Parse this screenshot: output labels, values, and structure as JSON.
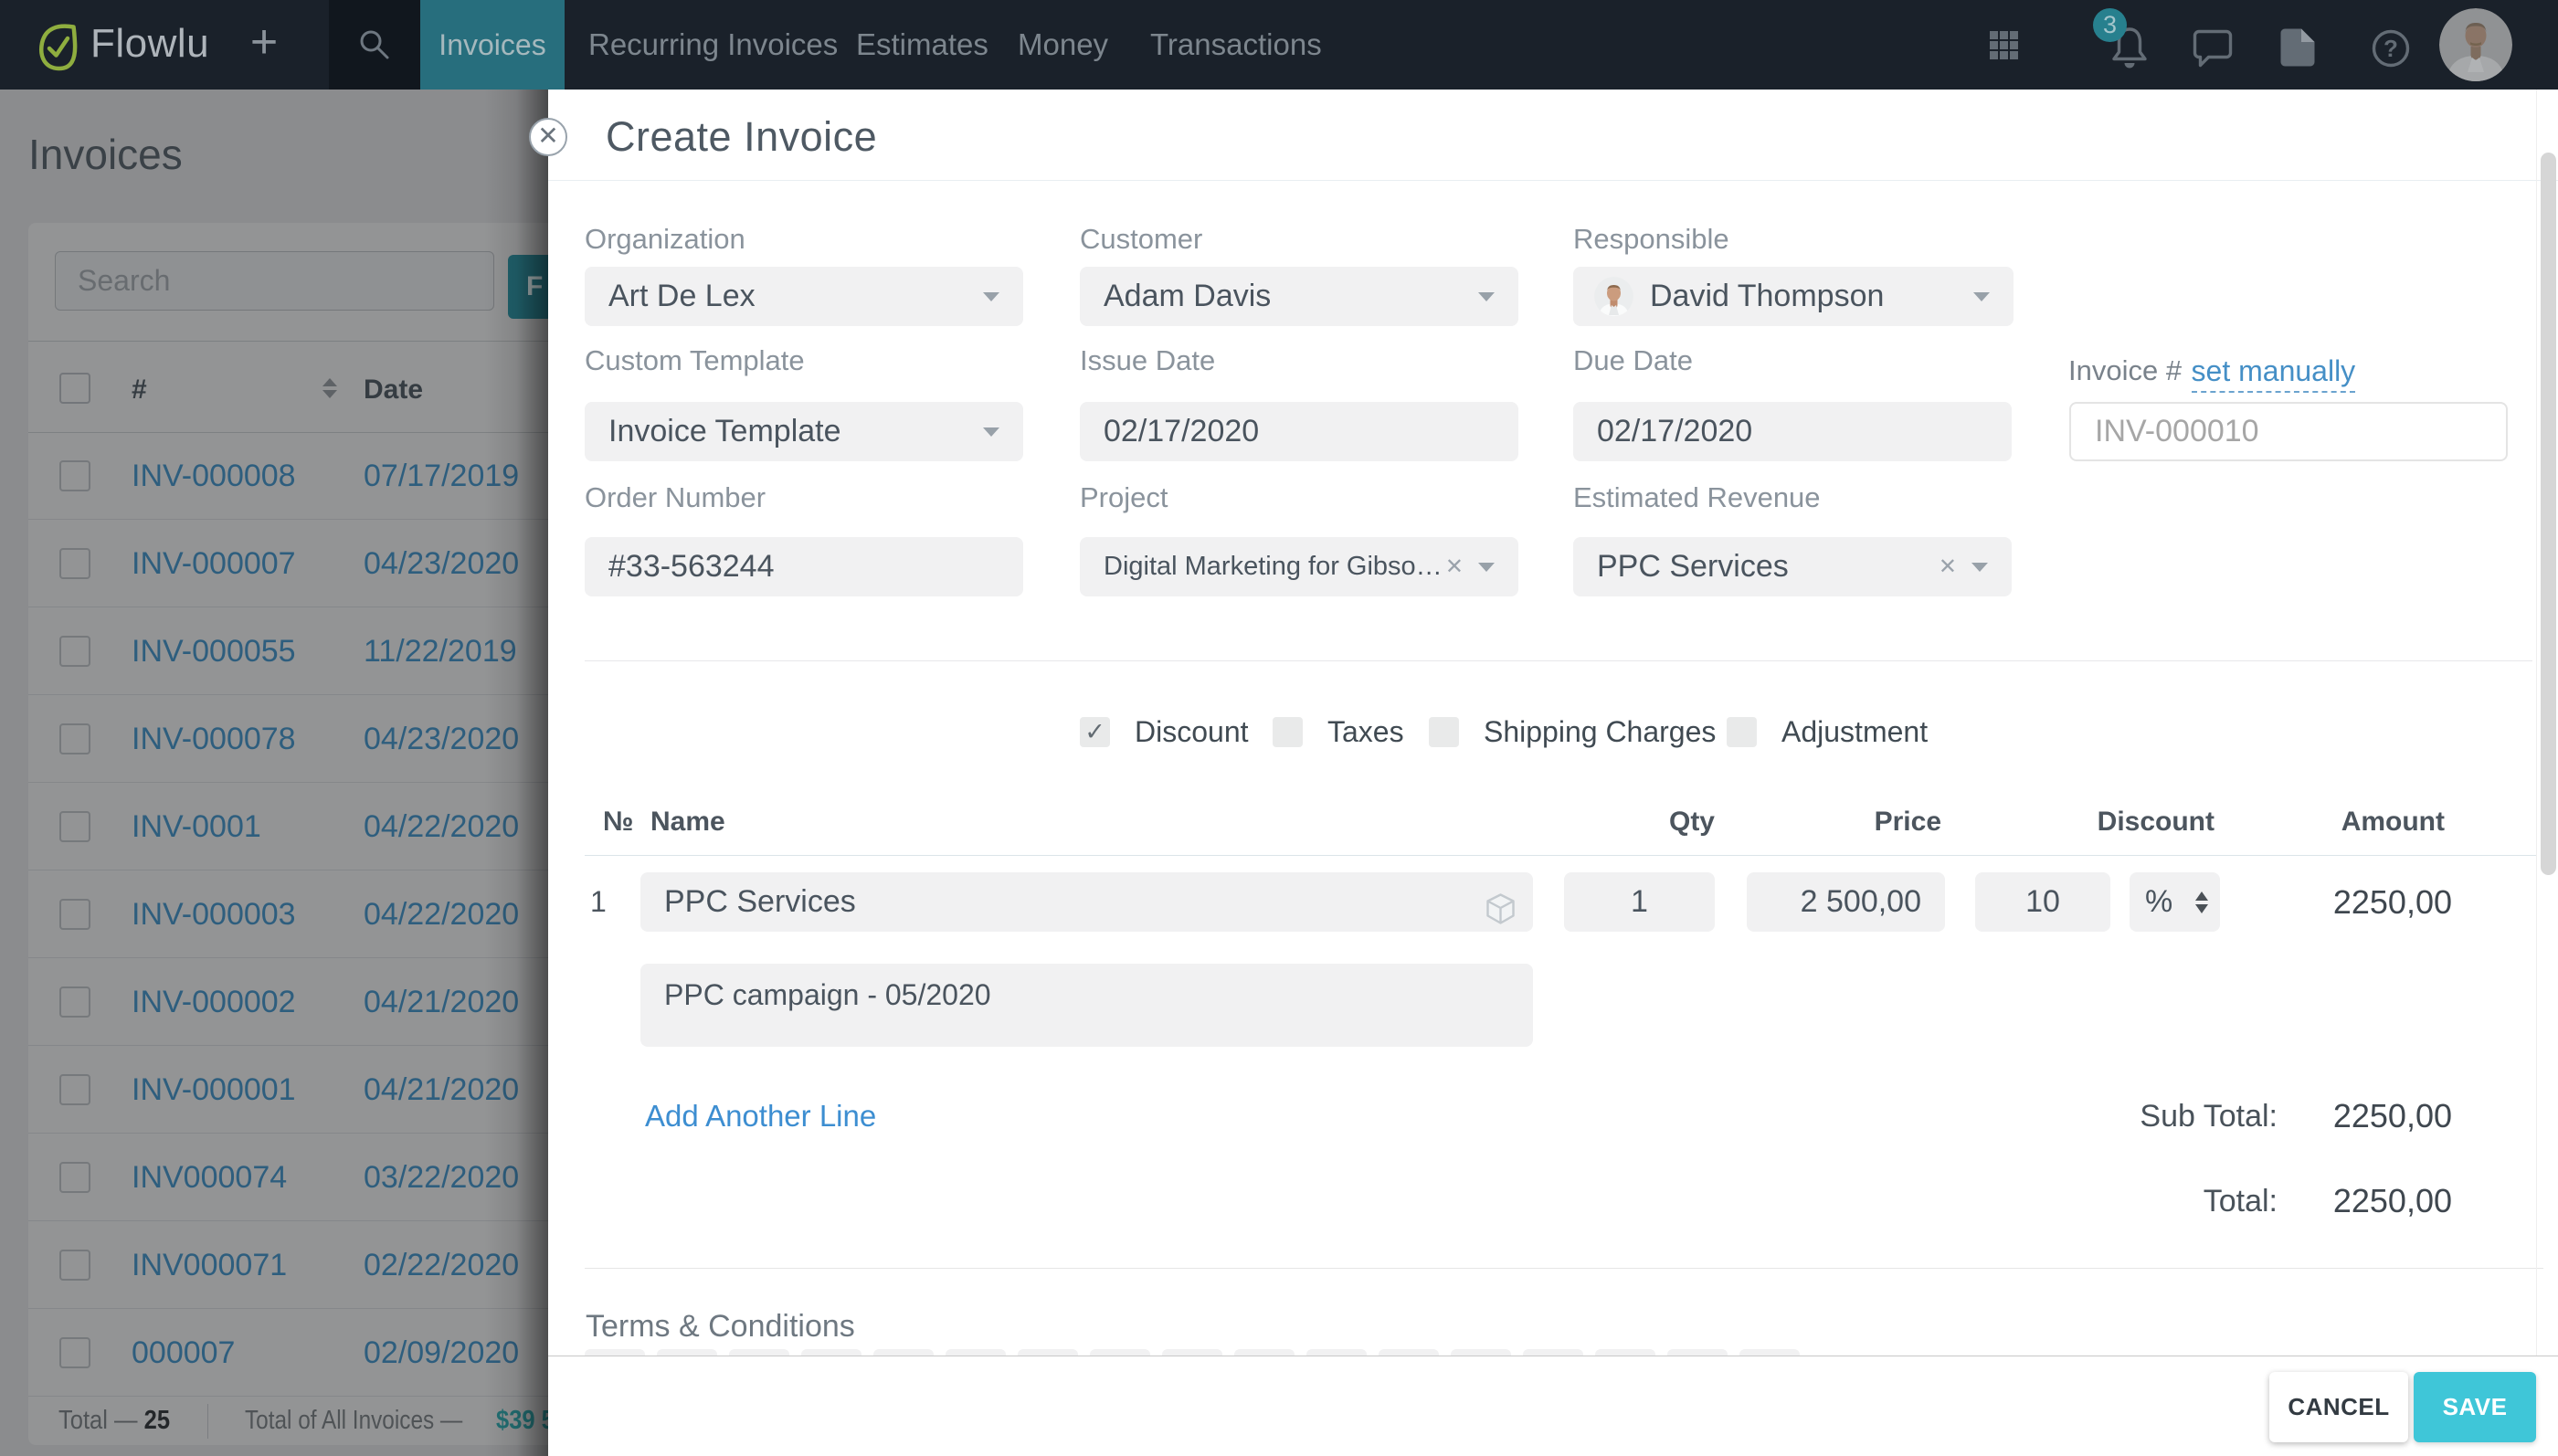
{
  "nav": {
    "logo_text": "Flowlu",
    "plus_label": "+",
    "tabs": [
      {
        "label": "Invoices",
        "active": true
      },
      {
        "label": "Recurring Invoices",
        "active": false
      },
      {
        "label": "Estimates",
        "active": false
      },
      {
        "label": "Money",
        "active": false
      },
      {
        "label": "Transactions",
        "active": false
      }
    ],
    "notification_badge": "3",
    "icons": [
      "apps-grid-icon",
      "bell-icon",
      "chat-icon",
      "document-icon",
      "help-icon",
      "user-avatar"
    ]
  },
  "page": {
    "title": "Invoices",
    "search_placeholder": "Search",
    "filter_label": "F",
    "table": {
      "columns": {
        "number": "#",
        "date": "Date"
      },
      "rows": [
        {
          "number": "INV-000008",
          "date": "07/17/2019"
        },
        {
          "number": "INV-000007",
          "date": "04/23/2020"
        },
        {
          "number": "INV-000055",
          "date": "11/22/2019"
        },
        {
          "number": "INV-000078",
          "date": "04/23/2020"
        },
        {
          "number": "INV-0001",
          "date": "04/22/2020"
        },
        {
          "number": "INV-000003",
          "date": "04/22/2020"
        },
        {
          "number": "INV-000002",
          "date": "04/21/2020"
        },
        {
          "number": "INV-000001",
          "date": "04/21/2020"
        },
        {
          "number": "INV000074",
          "date": "03/22/2020"
        },
        {
          "number": "INV000071",
          "date": "02/22/2020"
        },
        {
          "number": "000007",
          "date": "02/09/2020"
        }
      ]
    },
    "footer": {
      "total_label": "Total —",
      "total_count": "25",
      "all_invoices_label": "Total of All Invoices —",
      "all_invoices_amount": "$39 5"
    }
  },
  "modal": {
    "title": "Create Invoice",
    "close_label": "✕",
    "fields": {
      "organization": {
        "label": "Organization",
        "value": "Art De Lex"
      },
      "customer": {
        "label": "Customer",
        "value": "Adam Davis"
      },
      "responsible": {
        "label": "Responsible",
        "value": "David Thompson"
      },
      "custom_template": {
        "label": "Custom Template",
        "value": "Invoice Template"
      },
      "issue_date": {
        "label": "Issue Date",
        "value": "02/17/2020"
      },
      "due_date": {
        "label": "Due Date",
        "value": "02/17/2020"
      },
      "invoice_number": {
        "label": "Invoice #",
        "link": "set manually",
        "placeholder": "INV-000010"
      },
      "order_number": {
        "label": "Order Number",
        "value": "#33-563244"
      },
      "project": {
        "label": "Project",
        "value": "Digital Marketing for Gibso…"
      },
      "estimated_revenue": {
        "label": "Estimated Revenue",
        "value": "PPC Services"
      }
    },
    "options": [
      {
        "label": "Discount",
        "checked": true,
        "check_glyph": "✓"
      },
      {
        "label": "Taxes",
        "checked": false
      },
      {
        "label": "Shipping Charges",
        "checked": false
      },
      {
        "label": "Adjustment",
        "checked": false
      }
    ],
    "items_table": {
      "headers": {
        "number": "№",
        "name": "Name",
        "qty": "Qty",
        "price": "Price",
        "discount": "Discount",
        "amount": "Amount"
      },
      "rows": [
        {
          "index": "1",
          "name": "PPC Services",
          "description": "PPC campaign - 05/2020",
          "qty": "1",
          "price": "2 500,00",
          "discount": "10",
          "discount_unit": "%",
          "amount": "2250,00"
        }
      ],
      "add_line_label": "Add Another Line"
    },
    "totals": {
      "subtotal_label": "Sub Total:",
      "subtotal_value": "2250,00",
      "total_label": "Total:",
      "total_value": "2250,00"
    },
    "terms_label": "Terms & Conditions",
    "footer": {
      "cancel_label": "CANCEL",
      "save_label": "SAVE"
    }
  },
  "colors": {
    "accent_teal": "#3fc6d8",
    "nav_active_tab": "#276e7d",
    "link_blue": "#458fc6",
    "add_line_blue": "#3d8ed1",
    "nav_background": "#1a212a"
  }
}
